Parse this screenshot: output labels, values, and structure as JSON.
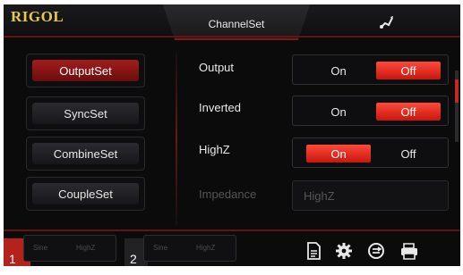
{
  "header": {
    "logo": "RIGOL",
    "title": "ChannelSet",
    "status_icon": "usb-icon"
  },
  "sidebar": {
    "items": [
      {
        "label": "OutputSet",
        "active": true
      },
      {
        "label": "SyncSet",
        "active": false
      },
      {
        "label": "CombineSet",
        "active": false
      },
      {
        "label": "CoupleSet",
        "active": false
      }
    ]
  },
  "settings": {
    "output": {
      "label": "Output",
      "on_label": "On",
      "off_label": "Off",
      "selected": "Off"
    },
    "inverted": {
      "label": "Inverted",
      "on_label": "On",
      "off_label": "Off",
      "selected": "Off"
    },
    "highz": {
      "label": "HighZ",
      "on_label": "On",
      "off_label": "Off",
      "selected": "On"
    },
    "impedance": {
      "label": "Impedance",
      "value": "HighZ",
      "enabled": false
    }
  },
  "channels": [
    {
      "number": "1",
      "waveform": "Sine",
      "load": "HighZ",
      "active": true
    },
    {
      "number": "2",
      "waveform": "Sine",
      "load": "HighZ",
      "active": false
    }
  ],
  "toolbar": {
    "icons": [
      "file-icon",
      "gear-icon",
      "sync-icon",
      "print-icon"
    ]
  },
  "colors": {
    "accent": "#e0302a",
    "background": "#0b0b0c",
    "logo": "#e6c84e"
  }
}
